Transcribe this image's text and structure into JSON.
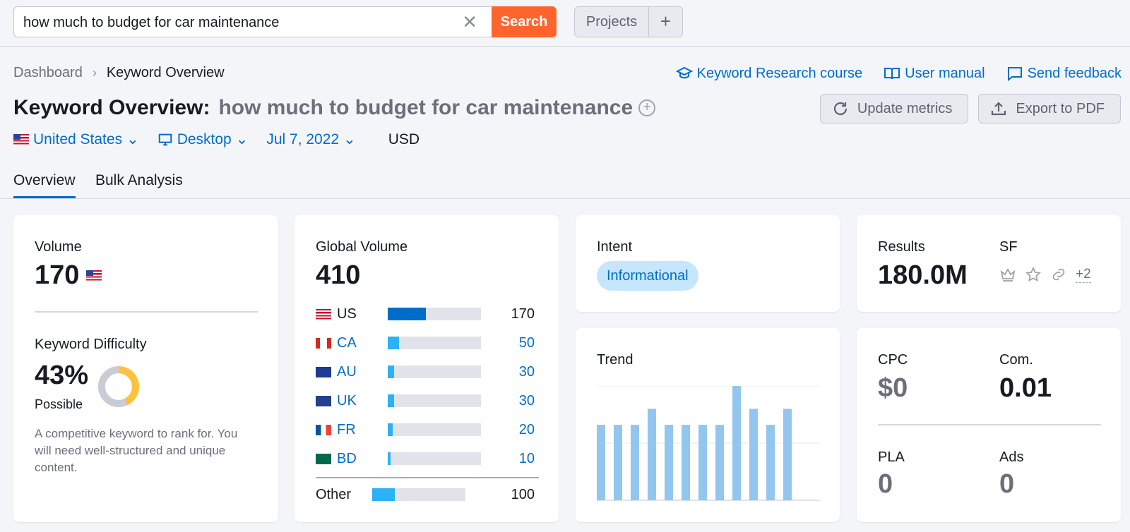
{
  "search": {
    "query": "how much to budget for car maintenance",
    "button": "Search"
  },
  "projects": {
    "label": "Projects",
    "add": "+"
  },
  "breadcrumb": {
    "root": "Dashboard",
    "current": "Keyword Overview"
  },
  "links": {
    "course": "Keyword Research course",
    "manual": "User manual",
    "feedback": "Send feedback"
  },
  "header": {
    "title": "Keyword Overview:",
    "keyword": "how much to budget for car maintenance"
  },
  "actions": {
    "update": "Update metrics",
    "export": "Export to PDF"
  },
  "filters": {
    "country": "United States",
    "device": "Desktop",
    "date": "Jul 7, 2022",
    "currency": "USD"
  },
  "tabs": [
    {
      "label": "Overview",
      "active": true
    },
    {
      "label": "Bulk Analysis",
      "active": false
    }
  ],
  "volume": {
    "label": "Volume",
    "value": "170"
  },
  "difficulty": {
    "label": "Keyword Difficulty",
    "value": "43%",
    "level": "Possible",
    "percent": 43,
    "description": "A competitive keyword to rank for. You will need well-structured and unique content."
  },
  "global": {
    "label": "Global Volume",
    "value": "410",
    "rows": [
      {
        "code": "US",
        "value": "170",
        "share": 0.41
      },
      {
        "code": "CA",
        "value": "50",
        "share": 0.12
      },
      {
        "code": "AU",
        "value": "30",
        "share": 0.07
      },
      {
        "code": "UK",
        "value": "30",
        "share": 0.07
      },
      {
        "code": "FR",
        "value": "20",
        "share": 0.05
      },
      {
        "code": "BD",
        "value": "10",
        "share": 0.03
      }
    ],
    "other": {
      "label": "Other",
      "value": "100",
      "share": 0.24
    }
  },
  "intent": {
    "label": "Intent",
    "value": "Informational"
  },
  "results": {
    "label": "Results",
    "value": "180.0M",
    "sf_label": "SF",
    "sf_more": "+2"
  },
  "trend": {
    "label": "Trend"
  },
  "cpc": {
    "label": "CPC",
    "value": "$0"
  },
  "com": {
    "label": "Com.",
    "value": "0.01"
  },
  "pla": {
    "label": "PLA",
    "value": "0"
  },
  "ads": {
    "label": "Ads",
    "value": "0"
  },
  "chart_data": {
    "type": "bar",
    "categories": [
      "1",
      "2",
      "3",
      "4",
      "5",
      "6",
      "7",
      "8",
      "9",
      "10",
      "11",
      "12"
    ],
    "values": [
      0.66,
      0.66,
      0.66,
      0.8,
      0.66,
      0.66,
      0.66,
      0.66,
      1.0,
      0.8,
      0.66,
      0.8
    ],
    "ylim": [
      0,
      1
    ],
    "color": "#93c6ef"
  }
}
